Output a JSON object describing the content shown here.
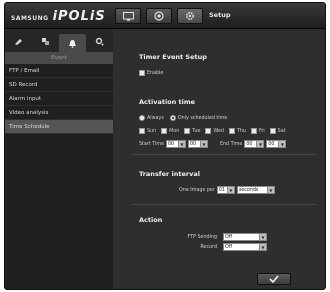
{
  "header": {
    "brand": "SAMSUNG",
    "product": "iPOLiS",
    "page_title": "Setup",
    "buttons": [
      "monitor-icon",
      "camera-icon",
      "gear-icon"
    ]
  },
  "sidebar": {
    "tabs": [
      "video-icon",
      "network-icon",
      "alarm-icon",
      "system-icon"
    ],
    "section": "Event",
    "items": [
      {
        "label": "FTP / Email"
      },
      {
        "label": "SD Record"
      },
      {
        "label": "Alarm input"
      },
      {
        "label": "Video analysis"
      },
      {
        "label": "Time Schedule",
        "selected": true
      }
    ]
  },
  "timer_event": {
    "title": "Timer Event Setup",
    "enable_label": "Enable"
  },
  "activation": {
    "title": "Activation time",
    "always_label": "Always",
    "scheduled_label": "Only scheduled time",
    "days": [
      "Sun",
      "Mon",
      "Tue",
      "Wed",
      "Thu",
      "Fri",
      "Sat"
    ],
    "start_label": "Start Time",
    "start_hour": "00",
    "start_min": "00",
    "end_label": "End Time",
    "end_hour": "00",
    "end_min": "00"
  },
  "transfer": {
    "title": "Transfer interval",
    "label": "One Image per",
    "value": "01",
    "unit": "seconds"
  },
  "action": {
    "title": "Action",
    "ftp_label": "FTP Sending",
    "ftp_value": "Off",
    "record_label": "Record",
    "record_value": "Off"
  },
  "apply": {
    "icon": "checkmark-icon"
  }
}
